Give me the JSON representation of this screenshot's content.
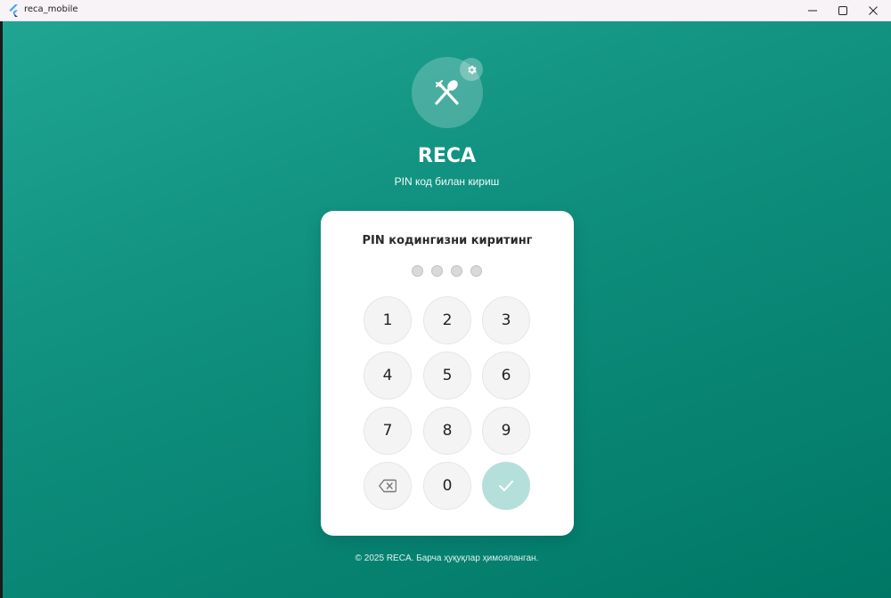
{
  "window": {
    "title": "reca_mobile",
    "app_icon": "flutter-icon",
    "controls": [
      "minimize-icon",
      "maximize-icon",
      "close-icon"
    ]
  },
  "header": {
    "logo_icon": "fork-spoon-icon",
    "settings_icon": "gear-icon",
    "app_name": "RECA",
    "subtitle": "PIN код билан кириш"
  },
  "pin_card": {
    "title": "PIN кодингизни киритинг",
    "pin_length": 4,
    "entered_digits": 0,
    "keys": [
      {
        "label": "1"
      },
      {
        "label": "2"
      },
      {
        "label": "3"
      },
      {
        "label": "4"
      },
      {
        "label": "5"
      },
      {
        "label": "6"
      },
      {
        "label": "7"
      },
      {
        "label": "8"
      },
      {
        "label": "9"
      },
      {
        "icon": "backspace-icon"
      },
      {
        "label": "0"
      },
      {
        "icon": "checkmark-icon"
      }
    ]
  },
  "footer": {
    "copyright": "© 2025 RECA. Барча ҳуқуқлар ҳимояланган."
  },
  "colors": {
    "gradient_start": "#20a593",
    "gradient_end": "#007766",
    "submit_button": "#b5dfda",
    "key_background": "#f4f4f4",
    "dot_empty": "#d9d9d9"
  }
}
